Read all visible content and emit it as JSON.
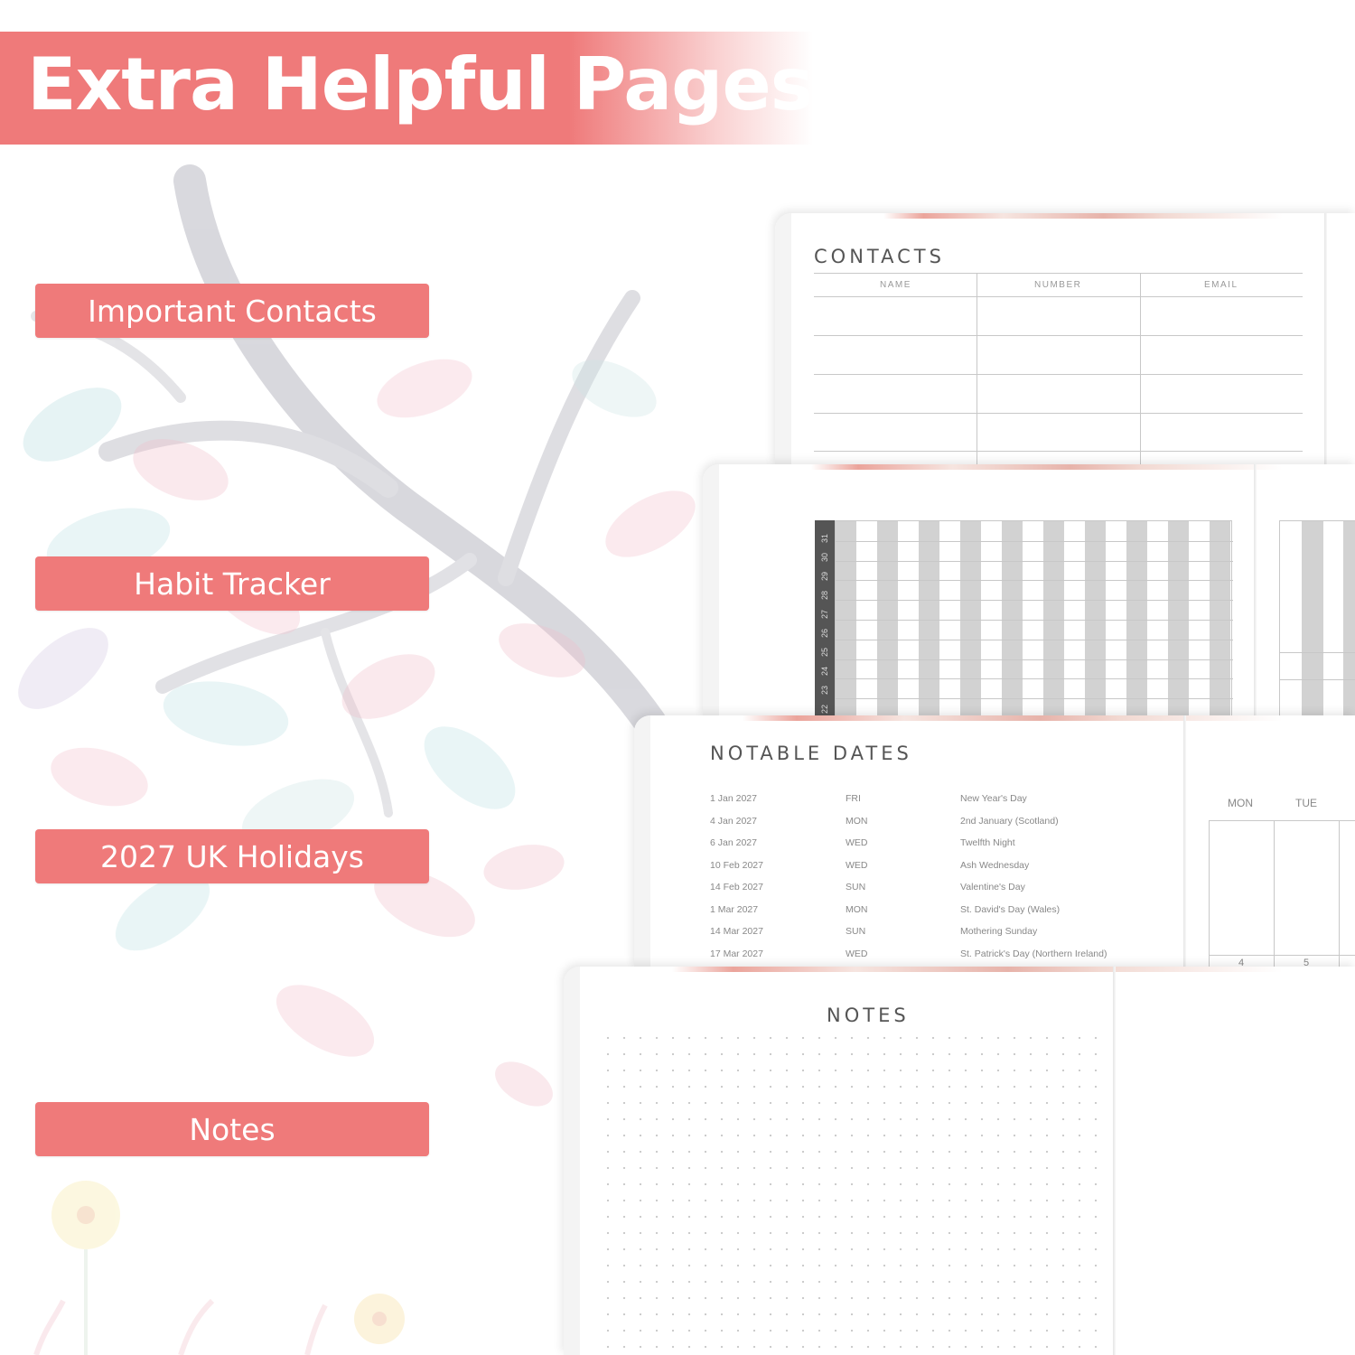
{
  "banner": {
    "title": "Extra Helpful Pages"
  },
  "features": [
    {
      "label": "Important Contacts"
    },
    {
      "label": "Habit Tracker"
    },
    {
      "label": "2027 UK Holidays"
    },
    {
      "label": "Notes"
    }
  ],
  "contacts_page": {
    "title": "CONTACTS",
    "columns": [
      "NAME",
      "NUMBER",
      "EMAIL"
    ]
  },
  "habit_tracker_page": {
    "day_numbers": [
      "22",
      "23",
      "24",
      "25",
      "26",
      "27",
      "28",
      "29",
      "30",
      "31"
    ]
  },
  "notable_dates_page": {
    "title": "NOTABLE DATES",
    "rows": [
      {
        "date": "1 Jan 2027",
        "day": "FRI",
        "event": "New Year's Day"
      },
      {
        "date": "4 Jan 2027",
        "day": "MON",
        "event": "2nd January (Scotland)"
      },
      {
        "date": "6 Jan 2027",
        "day": "WED",
        "event": "Twelfth Night"
      },
      {
        "date": "10 Feb 2027",
        "day": "WED",
        "event": "Ash Wednesday"
      },
      {
        "date": "14 Feb 2027",
        "day": "SUN",
        "event": "Valentine's Day"
      },
      {
        "date": "1 Mar 2027",
        "day": "MON",
        "event": "St. David's Day (Wales)"
      },
      {
        "date": "14 Mar 2027",
        "day": "SUN",
        "event": "Mothering Sunday"
      },
      {
        "date": "17 Mar 2027",
        "day": "WED",
        "event": "St. Patrick's Day (Northern Ireland)"
      }
    ],
    "calendar_days": [
      "MON",
      "TUE"
    ],
    "calendar_numbers": [
      "4",
      "5"
    ]
  },
  "notes_page": {
    "title": "NOTES"
  },
  "colors": {
    "accent": "#ef7a7a",
    "text_gray": "#555555",
    "stripe_gray": "#d2d2d2"
  }
}
